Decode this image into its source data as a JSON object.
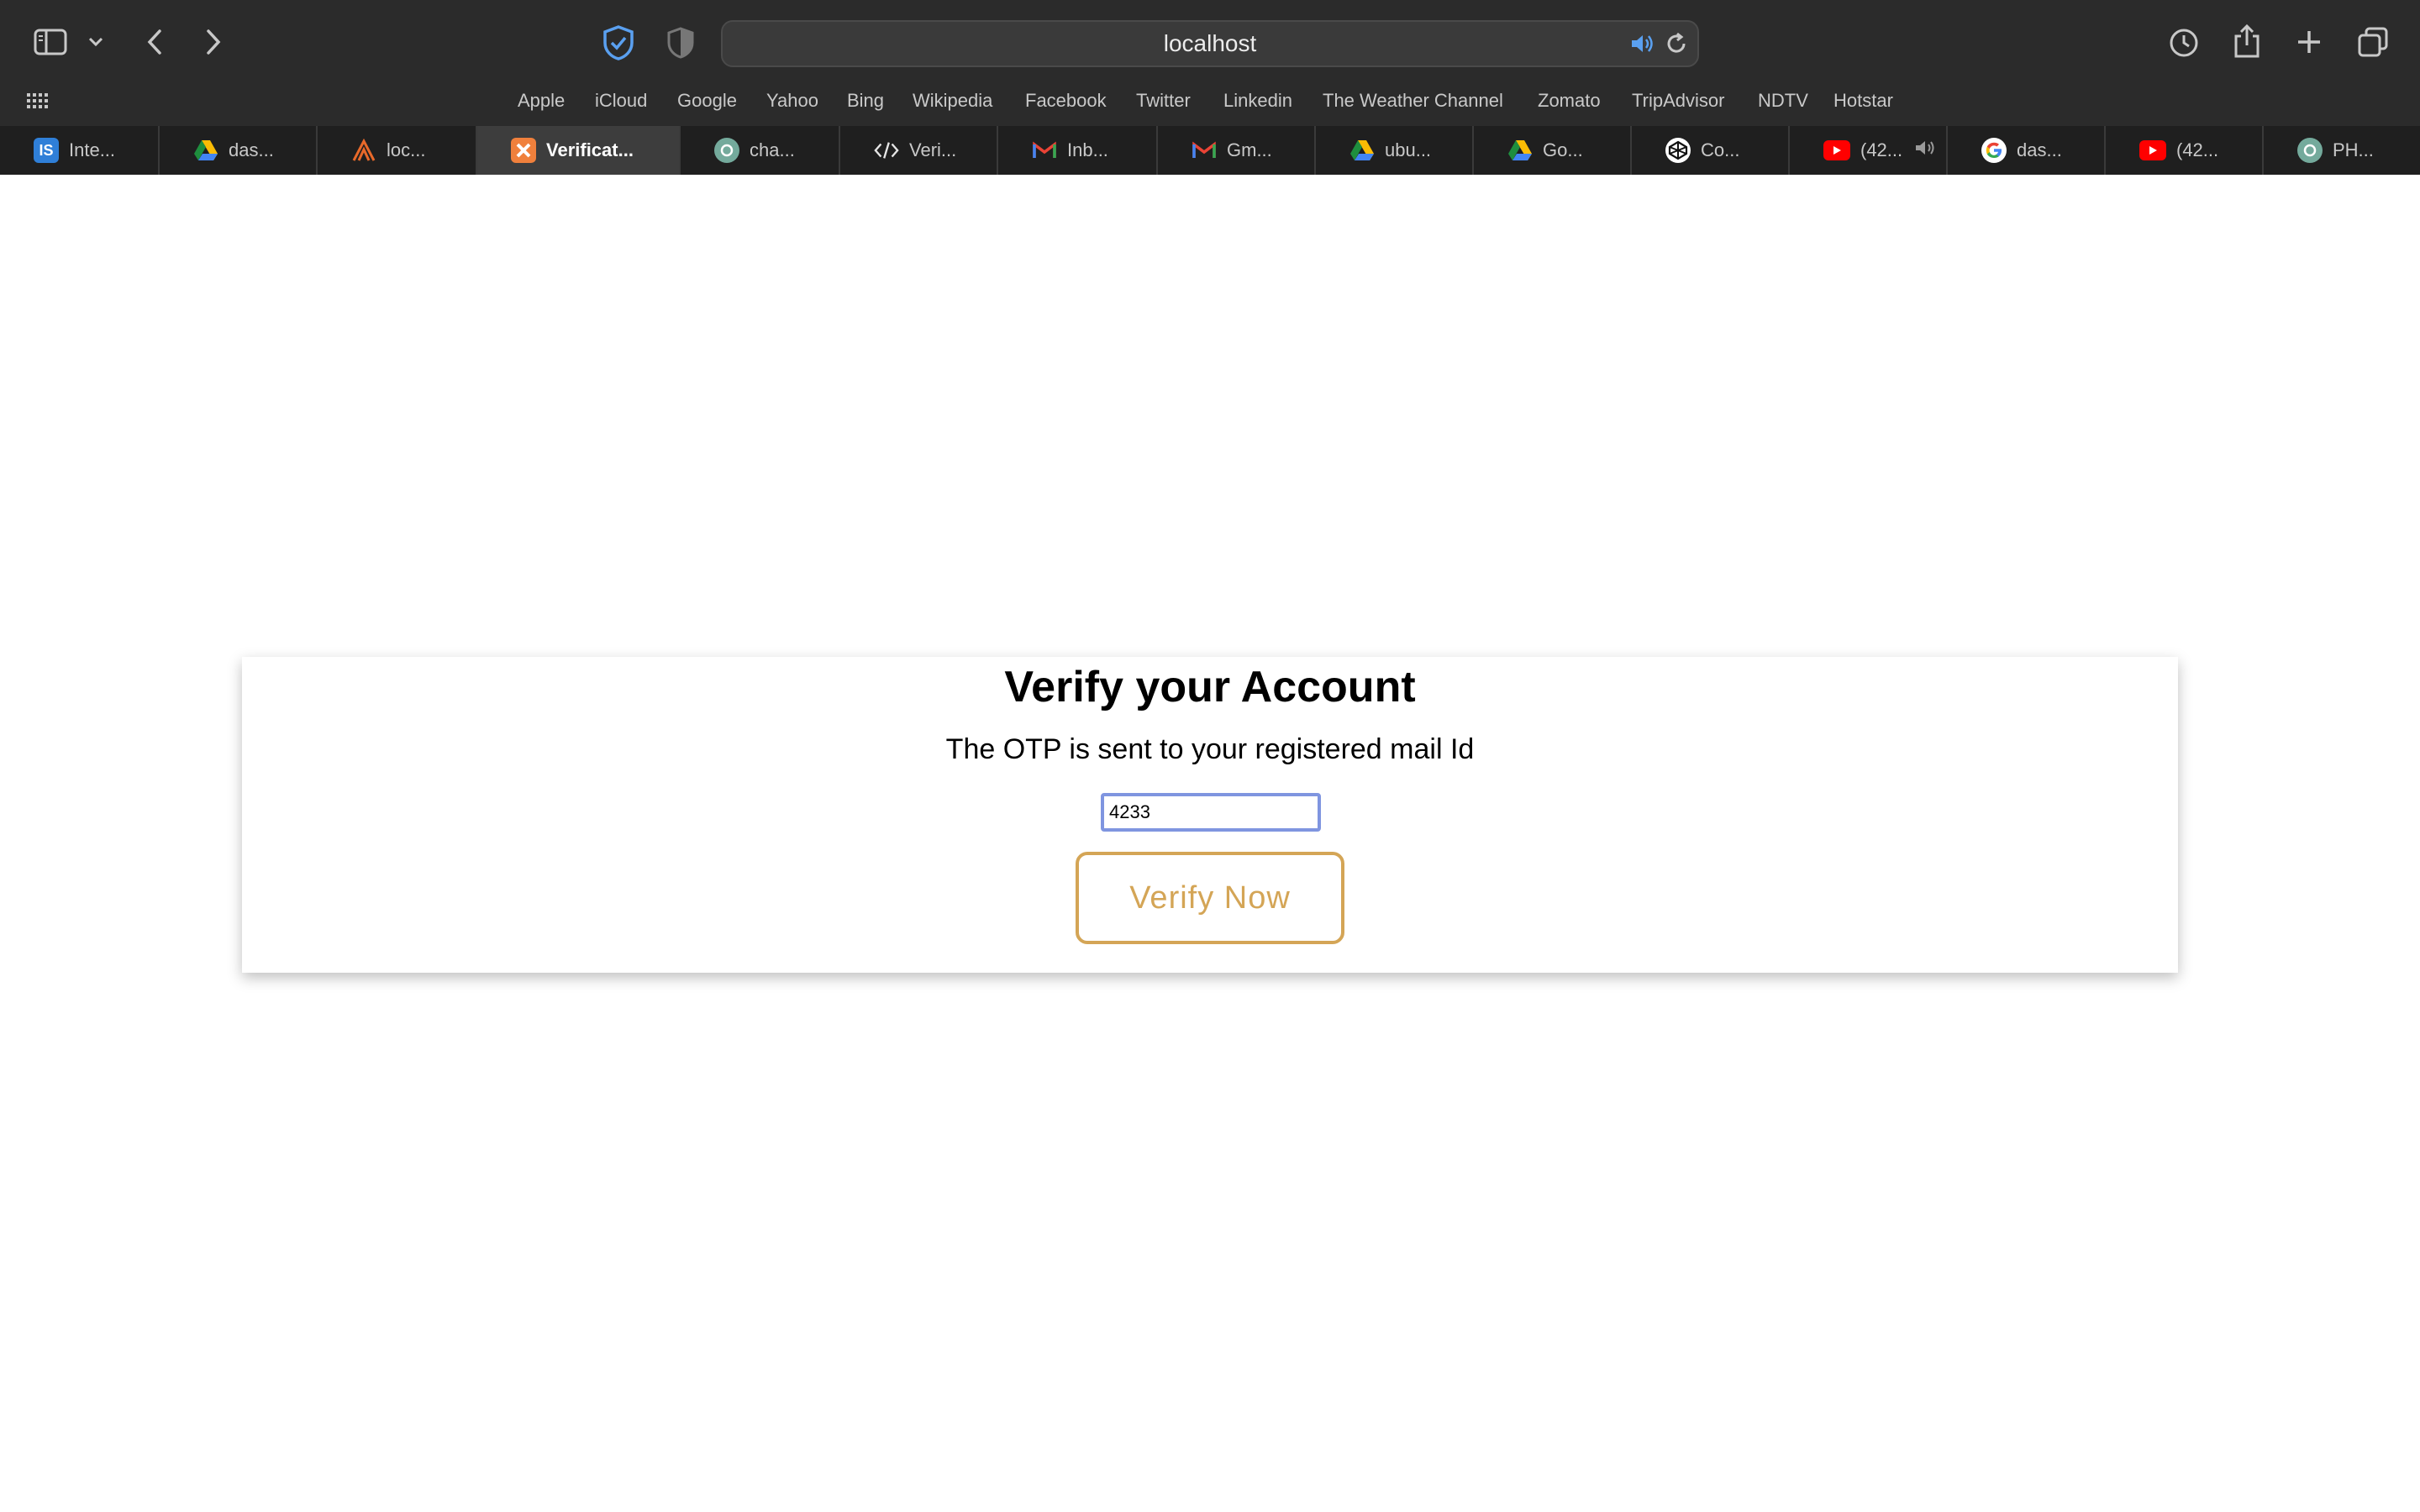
{
  "browser": {
    "url": "localhost",
    "favorites": [
      "Apple",
      "iCloud",
      "Google",
      "Yahoo",
      "Bing",
      "Wikipedia",
      "Facebook",
      "Twitter",
      "Linkedin",
      "The Weather Channel",
      "Zomato",
      "TripAdvisor",
      "NDTV",
      "Hotstar"
    ],
    "tabs": [
      {
        "label": "Inte...",
        "icon": "is-icon",
        "badge": "IS"
      },
      {
        "label": "das...",
        "icon": "google-drive-icon"
      },
      {
        "label": "loc...",
        "icon": "xampp-icon"
      },
      {
        "label": "Verificat...",
        "icon": "xampp-icon",
        "active": true
      },
      {
        "label": "cha...",
        "icon": "chatgpt-icon"
      },
      {
        "label": "Veri...",
        "icon": "code-icon"
      },
      {
        "label": "Inb...",
        "icon": "gmail-icon"
      },
      {
        "label": "Gm...",
        "icon": "gmail-icon"
      },
      {
        "label": "ubu...",
        "icon": "google-drive-icon"
      },
      {
        "label": "Go...",
        "icon": "google-drive-icon"
      },
      {
        "label": "Co...",
        "icon": "codepen-icon"
      },
      {
        "label": "(42...",
        "icon": "youtube-icon",
        "audio": true
      },
      {
        "label": "das...",
        "icon": "google-icon"
      },
      {
        "label": "(42...",
        "icon": "youtube-icon"
      },
      {
        "label": "PH...",
        "icon": "chatgpt-icon"
      }
    ]
  },
  "page": {
    "title": "Verify your Account",
    "subtitle": "The OTP is sent to your registered mail Id",
    "otp_value": "4233",
    "verify_button": "Verify Now"
  },
  "colors": {
    "button_accent": "#d4a556",
    "input_focus": "#7f95e0"
  }
}
